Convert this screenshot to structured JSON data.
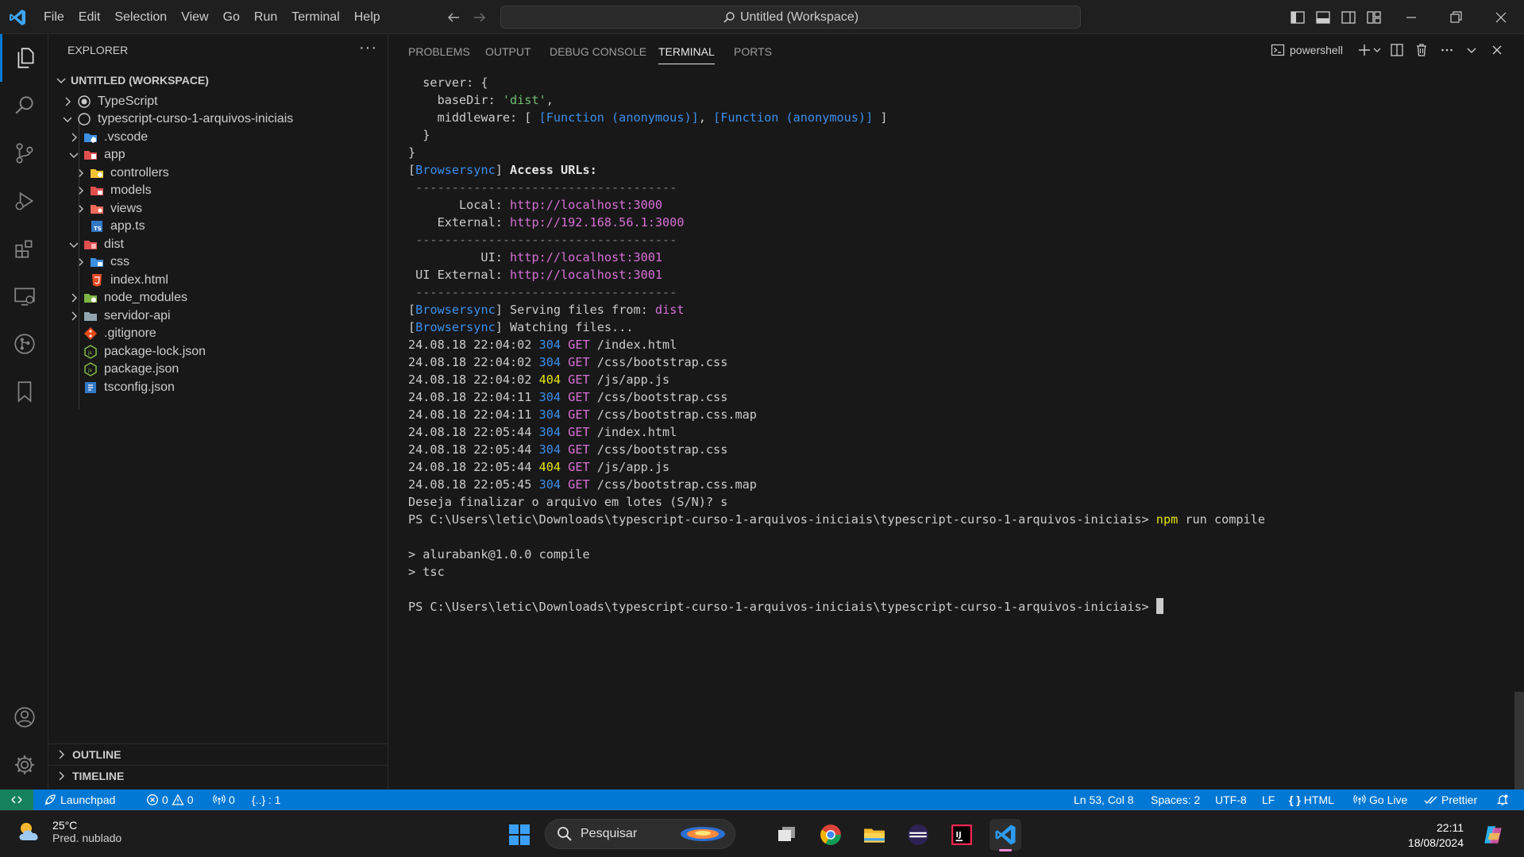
{
  "titlebar": {
    "menu": [
      "File",
      "Edit",
      "Selection",
      "View",
      "Go",
      "Run",
      "Terminal",
      "Help"
    ],
    "command_center": "Untitled (Workspace)"
  },
  "sidebar": {
    "title": "EXPLORER",
    "more": "···",
    "workspace": "UNTITLED (WORKSPACE)",
    "tree": [
      {
        "label": "TypeScript",
        "icon": "circle-dot-icon",
        "chevron": "right"
      },
      {
        "label": "typescript-curso-1-arquivos-iniciais",
        "icon": "circle-icon",
        "chevron": "down"
      },
      {
        "label": ".vscode",
        "icon": "folder-vscode-icon",
        "chevron": "right"
      },
      {
        "label": "app",
        "icon": "folder-app-icon",
        "chevron": "down"
      },
      {
        "label": "controllers",
        "icon": "folder-controllers-icon",
        "chevron": "right"
      },
      {
        "label": "models",
        "icon": "folder-models-icon",
        "chevron": "right"
      },
      {
        "label": "views",
        "icon": "folder-views-icon",
        "chevron": "right"
      },
      {
        "label": "app.ts",
        "icon": "typescript-file-icon",
        "chevron": "none"
      },
      {
        "label": "dist",
        "icon": "folder-dist-icon",
        "chevron": "down"
      },
      {
        "label": "css",
        "icon": "folder-css-icon",
        "chevron": "right"
      },
      {
        "label": "index.html",
        "icon": "html-file-icon",
        "chevron": "none"
      },
      {
        "label": "node_modules",
        "icon": "folder-node-icon",
        "chevron": "right"
      },
      {
        "label": "servidor-api",
        "icon": "folder-icon",
        "chevron": "right"
      },
      {
        "label": ".gitignore",
        "icon": "git-file-icon",
        "chevron": "none"
      },
      {
        "label": "package-lock.json",
        "icon": "node-json-icon",
        "chevron": "none"
      },
      {
        "label": "package.json",
        "icon": "node-json-icon",
        "chevron": "none"
      },
      {
        "label": "tsconfig.json",
        "icon": "tsconfig-icon",
        "chevron": "none"
      }
    ],
    "outline": "OUTLINE",
    "timeline": "TIMELINE"
  },
  "panel": {
    "tabs": [
      "PROBLEMS",
      "OUTPUT",
      "DEBUG CONSOLE",
      "TERMINAL",
      "PORTS"
    ],
    "active_tab": "TERMINAL",
    "shell": "powershell"
  },
  "terminal": {
    "lines": [
      [
        {
          "t": "  server: {",
          "c": ""
        }
      ],
      [
        {
          "t": "    baseDir: ",
          "c": ""
        },
        {
          "t": "'dist'",
          "c": "c-str"
        },
        {
          "t": ",",
          "c": ""
        }
      ],
      [
        {
          "t": "    middleware: [ ",
          "c": ""
        },
        {
          "t": "[Function (anonymous)]",
          "c": "c-blue"
        },
        {
          "t": ", ",
          "c": ""
        },
        {
          "t": "[Function (anonymous)]",
          "c": "c-blue"
        },
        {
          "t": " ]",
          "c": ""
        }
      ],
      [
        {
          "t": "  }",
          "c": ""
        }
      ],
      [
        {
          "t": "}",
          "c": ""
        }
      ],
      [
        {
          "t": "[",
          "c": ""
        },
        {
          "t": "Browsersync",
          "c": "c-blue"
        },
        {
          "t": "] ",
          "c": ""
        },
        {
          "t": "Access URLs:",
          "c": "c-bold"
        }
      ],
      [
        {
          "t": " ------------------------------------",
          "c": "c-dim"
        }
      ],
      [
        {
          "t": "       Local: ",
          "c": ""
        },
        {
          "t": "http://localhost:3000",
          "c": "c-mag"
        }
      ],
      [
        {
          "t": "    External: ",
          "c": ""
        },
        {
          "t": "http://192.168.56.1:3000",
          "c": "c-mag"
        }
      ],
      [
        {
          "t": " ------------------------------------",
          "c": "c-dim"
        }
      ],
      [
        {
          "t": "          UI: ",
          "c": ""
        },
        {
          "t": "http://localhost:3001",
          "c": "c-mag"
        }
      ],
      [
        {
          "t": " UI External: ",
          "c": ""
        },
        {
          "t": "http://localhost:3001",
          "c": "c-mag"
        }
      ],
      [
        {
          "t": " ------------------------------------",
          "c": "c-dim"
        }
      ],
      [
        {
          "t": "[",
          "c": ""
        },
        {
          "t": "Browsersync",
          "c": "c-blue"
        },
        {
          "t": "] Serving files from: ",
          "c": ""
        },
        {
          "t": "dist",
          "c": "c-mag"
        }
      ],
      [
        {
          "t": "[",
          "c": ""
        },
        {
          "t": "Browsersync",
          "c": "c-blue"
        },
        {
          "t": "] Watching files...",
          "c": ""
        }
      ],
      [
        {
          "t": "24.08.18 22:04:02 ",
          "c": ""
        },
        {
          "t": "304",
          "c": "c-blue"
        },
        {
          "t": " GET",
          "c": "c-mag"
        },
        {
          "t": " /index.html",
          "c": ""
        }
      ],
      [
        {
          "t": "24.08.18 22:04:02 ",
          "c": ""
        },
        {
          "t": "304",
          "c": "c-blue"
        },
        {
          "t": " GET",
          "c": "c-mag"
        },
        {
          "t": " /css/bootstrap.css",
          "c": ""
        }
      ],
      [
        {
          "t": "24.08.18 22:04:02 ",
          "c": ""
        },
        {
          "t": "404",
          "c": "c-yel"
        },
        {
          "t": " GET",
          "c": "c-mag"
        },
        {
          "t": " /js/app.js",
          "c": ""
        }
      ],
      [
        {
          "t": "24.08.18 22:04:11 ",
          "c": ""
        },
        {
          "t": "304",
          "c": "c-blue"
        },
        {
          "t": " GET",
          "c": "c-mag"
        },
        {
          "t": " /css/bootstrap.css",
          "c": ""
        }
      ],
      [
        {
          "t": "24.08.18 22:04:11 ",
          "c": ""
        },
        {
          "t": "304",
          "c": "c-blue"
        },
        {
          "t": " GET",
          "c": "c-mag"
        },
        {
          "t": " /css/bootstrap.css.map",
          "c": ""
        }
      ],
      [
        {
          "t": "24.08.18 22:05:44 ",
          "c": ""
        },
        {
          "t": "304",
          "c": "c-blue"
        },
        {
          "t": " GET",
          "c": "c-mag"
        },
        {
          "t": " /index.html",
          "c": ""
        }
      ],
      [
        {
          "t": "24.08.18 22:05:44 ",
          "c": ""
        },
        {
          "t": "304",
          "c": "c-blue"
        },
        {
          "t": " GET",
          "c": "c-mag"
        },
        {
          "t": " /css/bootstrap.css",
          "c": ""
        }
      ],
      [
        {
          "t": "24.08.18 22:05:44 ",
          "c": ""
        },
        {
          "t": "404",
          "c": "c-yel"
        },
        {
          "t": " GET",
          "c": "c-mag"
        },
        {
          "t": " /js/app.js",
          "c": ""
        }
      ],
      [
        {
          "t": "24.08.18 22:05:45 ",
          "c": ""
        },
        {
          "t": "304",
          "c": "c-blue"
        },
        {
          "t": " GET",
          "c": "c-mag"
        },
        {
          "t": " /css/bootstrap.css.map",
          "c": ""
        }
      ],
      [
        {
          "t": "Deseja finalizar o arquivo em lotes (S/N)? s",
          "c": ""
        }
      ],
      [
        {
          "t": "PS C:\\Users\\letic\\Downloads\\typescript-curso-1-arquivos-iniciais\\typescript-curso-1-arquivos-iniciais> ",
          "c": ""
        },
        {
          "t": "npm",
          "c": "c-yel"
        },
        {
          "t": " run compile",
          "c": ""
        }
      ],
      [
        {
          "t": "",
          "c": ""
        }
      ],
      [
        {
          "t": "> alurabank@1.0.0 compile",
          "c": ""
        }
      ],
      [
        {
          "t": "> tsc",
          "c": ""
        }
      ],
      [
        {
          "t": "",
          "c": ""
        }
      ],
      [
        {
          "t": "PS C:\\Users\\letic\\Downloads\\typescript-curso-1-arquivos-iniciais\\typescript-curso-1-arquivos-iniciais> ",
          "c": ""
        },
        {
          "t": "",
          "c": "cursor"
        }
      ]
    ]
  },
  "statusbar": {
    "launchpad": "Launchpad",
    "errors": "0",
    "warnings": "0",
    "ports": "0",
    "json_path": "{..} : 1",
    "cursor_pos": "Ln 53, Col 8",
    "spaces": "Spaces: 2",
    "encoding": "UTF-8",
    "eol": "LF",
    "language": "HTML",
    "golive": "Go Live",
    "prettier": "Prettier"
  },
  "taskbar": {
    "weather_temp": "25°C",
    "weather_desc": "Pred. nublado",
    "search_placeholder": "Pesquisar",
    "time": "22:11",
    "date": "18/08/2024"
  },
  "colors": {
    "accent": "#0078d4",
    "remote": "#16825d",
    "editor_bg": "#181818"
  }
}
